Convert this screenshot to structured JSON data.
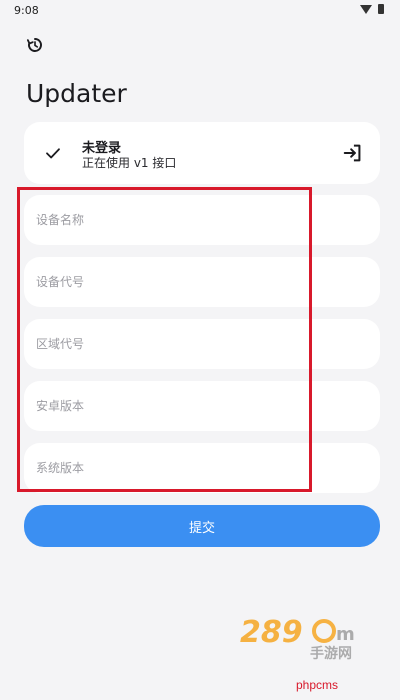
{
  "status_bar": {
    "time": "9:08",
    "icons": [
      "wifi-icon",
      "battery-icon"
    ]
  },
  "toolbar": {
    "history_icon": "history-icon"
  },
  "page": {
    "title": "Updater"
  },
  "status_card": {
    "icon": "check-icon",
    "title": "未登录",
    "subtitle": "正在使用 v1 接口",
    "action_icon": "login-icon"
  },
  "form": {
    "fields": [
      {
        "placeholder": "设备名称",
        "value": ""
      },
      {
        "placeholder": "设备代号",
        "value": ""
      },
      {
        "placeholder": "区域代号",
        "value": ""
      },
      {
        "placeholder": "安卓版本",
        "value": ""
      },
      {
        "placeholder": "系统版本",
        "value": ""
      }
    ],
    "submit_label": "提交"
  },
  "watermark": {
    "logo_text": "289.com 手游网",
    "text": "phpcms"
  },
  "colors": {
    "accent": "#3b8ff2",
    "background": "#f4f4f6",
    "card": "#ffffff",
    "highlight": "#d8192b"
  }
}
